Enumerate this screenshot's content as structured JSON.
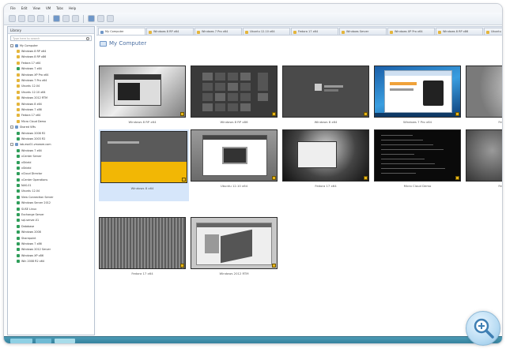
{
  "window": {
    "menu": [
      "File",
      "Edit",
      "View",
      "VM",
      "Tabs",
      "Help"
    ]
  },
  "sidebar": {
    "header": "Library",
    "search_placeholder": "Type here to search",
    "tree": [
      {
        "label": "My Computer",
        "level": 0,
        "expand": "-",
        "color": "#6f97c8"
      },
      {
        "label": "Windows 8 RP x64",
        "level": 1,
        "color": "#e4b53c"
      },
      {
        "label": "Windows 8 RP x86",
        "level": 1,
        "color": "#e4b53c"
      },
      {
        "label": "Fedora 17 x64",
        "level": 1,
        "color": "#e4b53c"
      },
      {
        "label": "Windows 7 x64",
        "level": 1,
        "color": "#2f9e5a"
      },
      {
        "label": "Windows XP Pro x64",
        "level": 1,
        "color": "#e4b53c"
      },
      {
        "label": "Windows 7 Pro x64",
        "level": 1,
        "color": "#e4b53c"
      },
      {
        "label": "Ubuntu 12.04",
        "level": 1,
        "color": "#e4b53c"
      },
      {
        "label": "Ubuntu 12.10 x64",
        "level": 1,
        "color": "#e4b53c"
      },
      {
        "label": "Windows 2012 RTM",
        "level": 1,
        "color": "#e4b53c"
      },
      {
        "label": "Windows 8 x64",
        "level": 1,
        "color": "#e4b53c"
      },
      {
        "label": "Windows 7 x86",
        "level": 1,
        "color": "#e4b53c"
      },
      {
        "label": "Fedora 17 x64",
        "level": 1,
        "color": "#e4b53c"
      },
      {
        "label": "Micro Cloud Demo",
        "level": 1,
        "color": "#e4b53c"
      },
      {
        "label": "Shared VMs",
        "level": 0,
        "expand": "-",
        "color": "#6f97c8"
      },
      {
        "label": "Windows 2008 R2",
        "level": 1,
        "color": "#2f9e5a"
      },
      {
        "label": "Windows 2003 R2",
        "level": 1,
        "color": "#2f9e5a"
      },
      {
        "label": "lab-esx01.vmware.com",
        "level": 0,
        "expand": "-",
        "color": "#6f97c8"
      },
      {
        "label": "Windows 7 x64",
        "level": 1,
        "color": "#2f9e5a"
      },
      {
        "label": "vCenter Server",
        "level": 1,
        "color": "#2f9e5a"
      },
      {
        "label": "vShield",
        "level": 1,
        "color": "#2f9e5a"
      },
      {
        "label": "vShield",
        "level": 1,
        "color": "#2f9e5a"
      },
      {
        "label": "vCloud Director",
        "level": 1,
        "color": "#2f9e5a"
      },
      {
        "label": "vCenter Operations",
        "level": 1,
        "color": "#2f9e5a"
      },
      {
        "label": "NAS-01",
        "level": 1,
        "color": "#2f9e5a"
      },
      {
        "label": "Ubuntu 12.04",
        "level": 1,
        "color": "#2f9e5a"
      },
      {
        "label": "View Connection Server",
        "level": 1,
        "color": "#2f9e5a"
      },
      {
        "label": "Windows Server 2012",
        "level": 1,
        "color": "#2f9e5a"
      },
      {
        "label": "SUSE Linux",
        "level": 1,
        "color": "#2f9e5a"
      },
      {
        "label": "Exchange Server",
        "level": 1,
        "color": "#2f9e5a"
      },
      {
        "label": "sql-server-01",
        "level": 1,
        "color": "#2f9e5a"
      },
      {
        "label": "Database",
        "level": 1,
        "color": "#2f9e5a"
      },
      {
        "label": "Windows 2008",
        "level": 1,
        "color": "#2f9e5a"
      },
      {
        "label": "Sharepoint",
        "level": 1,
        "color": "#2f9e5a"
      },
      {
        "label": "Windows 7 x86",
        "level": 1,
        "color": "#2f9e5a"
      },
      {
        "label": "Windows 2012 Server",
        "level": 1,
        "color": "#2f9e5a"
      },
      {
        "label": "Windows XP x86",
        "level": 1,
        "color": "#2f9e5a"
      },
      {
        "label": "Win 2008 R2 x64",
        "level": 1,
        "color": "#2f9e5a"
      }
    ]
  },
  "tabs": [
    "My Computer",
    "Windows 8 RP x64",
    "Windows 7 Pro x64",
    "Ubuntu 12.10 x64",
    "Fedora 17 x64",
    "Windows Server",
    "Windows XP Pro x64",
    "Windows 8 RP x86",
    "Ubuntu 12.04"
  ],
  "main": {
    "path_label": "My Computer"
  },
  "vms": [
    {
      "caption": "Windows 8 RP x64",
      "style": "win8-desktop"
    },
    {
      "caption": "Windows 8 RP x86",
      "style": "win8-start"
    },
    {
      "caption": "Windows 8 x64",
      "style": "win8-login"
    },
    {
      "caption": "Windows 7 Pro x64",
      "style": "win7-browser"
    },
    {
      "caption": "Fedora 17 x64",
      "style": "gray-gradient"
    },
    {
      "caption": "Windows 8 x64",
      "style": "win8-yellow",
      "selected": true
    },
    {
      "caption": "Ubuntu 12.10 x64",
      "style": "ubuntu-laptop"
    },
    {
      "caption": "Fedora 17 x64",
      "style": "fedora-dark"
    },
    {
      "caption": "Micro Cloud Demo",
      "style": "console"
    },
    {
      "caption": "Fedora 17 x64",
      "style": "gray-dark"
    },
    {
      "caption": "Fedora 17 x64",
      "style": "stripes"
    },
    {
      "caption": "Windows 2012 RTM",
      "style": "server-cube"
    }
  ]
}
